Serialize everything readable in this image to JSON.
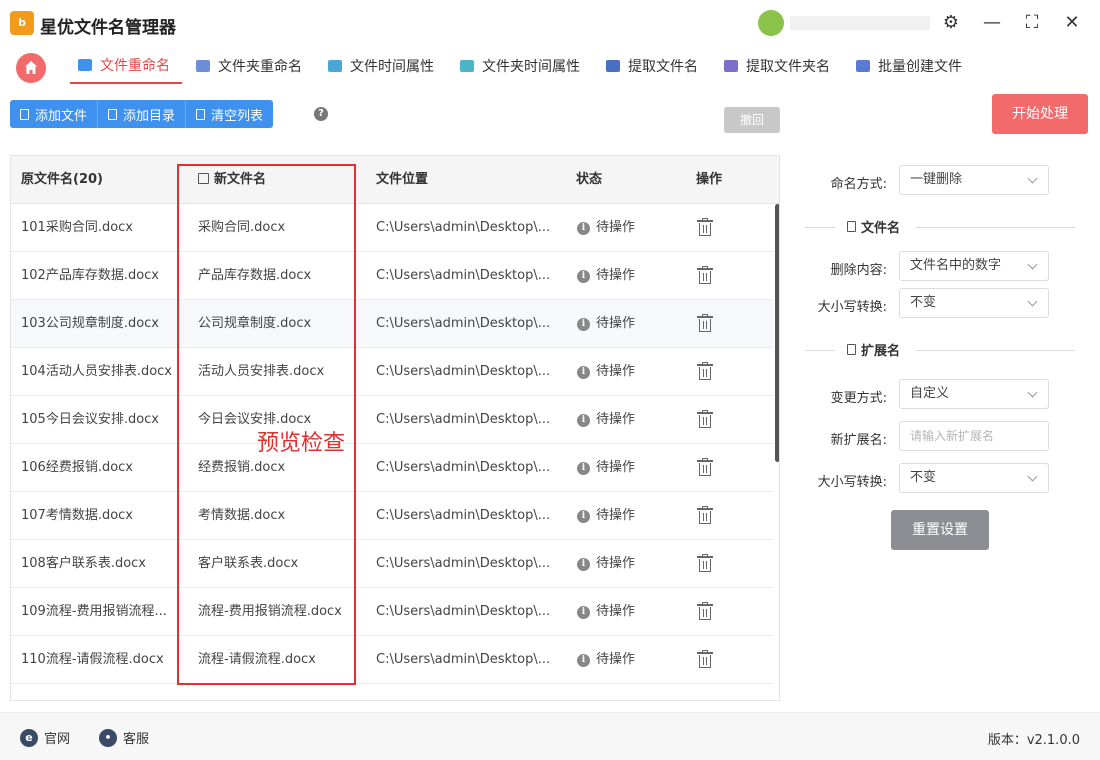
{
  "app": {
    "title": "星优文件名管理器",
    "logo_text": "b"
  },
  "window_controls": {
    "settings": "⚙",
    "minimize": "—",
    "maximize": "⛶",
    "close": "✕"
  },
  "tabs": [
    {
      "label": "文件重命名",
      "active": true,
      "icon": "file-rename-icon",
      "color": "#3f91f0"
    },
    {
      "label": "文件夹重命名",
      "active": false,
      "icon": "folder-rename-icon",
      "color": "#6a8ed8"
    },
    {
      "label": "文件时间属性",
      "active": false,
      "icon": "file-time-icon",
      "color": "#49a7d6"
    },
    {
      "label": "文件夹时间属性",
      "active": false,
      "icon": "folder-time-icon",
      "color": "#4cb4c9"
    },
    {
      "label": "提取文件名",
      "active": false,
      "icon": "extract-filename-icon",
      "color": "#4a6fc2"
    },
    {
      "label": "提取文件夹名",
      "active": false,
      "icon": "extract-foldername-icon",
      "color": "#7d6cc9"
    },
    {
      "label": "批量创建文件",
      "active": false,
      "icon": "batch-create-icon",
      "color": "#5a7ad6"
    }
  ],
  "toolbar": {
    "add_file": "添加文件",
    "add_dir": "添加目录",
    "clear_list": "清空列表",
    "help": "?",
    "undo": "撤回",
    "start": "开始处理"
  },
  "table": {
    "headers": {
      "original": "原文件名(20)",
      "new_name": "新文件名",
      "location": "文件位置",
      "status": "状态",
      "action": "操作"
    },
    "rows": [
      {
        "original": "101采购合同.docx",
        "new_name": "采购合同.docx",
        "location": "C:\\Users\\admin\\Desktop\\...",
        "status": "待操作"
      },
      {
        "original": "102产品库存数据.docx",
        "new_name": "产品库存数据.docx",
        "location": "C:\\Users\\admin\\Desktop\\...",
        "status": "待操作"
      },
      {
        "original": "103公司规章制度.docx",
        "new_name": "公司规章制度.docx",
        "location": "C:\\Users\\admin\\Desktop\\...",
        "status": "待操作"
      },
      {
        "original": "104活动人员安排表.docx",
        "new_name": "活动人员安排表.docx",
        "location": "C:\\Users\\admin\\Desktop\\...",
        "status": "待操作"
      },
      {
        "original": "105今日会议安排.docx",
        "new_name": "今日会议安排.docx",
        "location": "C:\\Users\\admin\\Desktop\\...",
        "status": "待操作"
      },
      {
        "original": "106经费报销.docx",
        "new_name": "经费报销.docx",
        "location": "C:\\Users\\admin\\Desktop\\...",
        "status": "待操作"
      },
      {
        "original": "107考情数据.docx",
        "new_name": "考情数据.docx",
        "location": "C:\\Users\\admin\\Desktop\\...",
        "status": "待操作"
      },
      {
        "original": "108客户联系表.docx",
        "new_name": "客户联系表.docx",
        "location": "C:\\Users\\admin\\Desktop\\...",
        "status": "待操作"
      },
      {
        "original": "109流程-费用报销流程...",
        "new_name": "流程-费用报销流程.docx",
        "location": "C:\\Users\\admin\\Desktop\\...",
        "status": "待操作"
      },
      {
        "original": "110流程-请假流程.docx",
        "new_name": "流程-请假流程.docx",
        "location": "C:\\Users\\admin\\Desktop\\...",
        "status": "待操作"
      }
    ],
    "highlighted_row": 2
  },
  "annotation": "预览检查",
  "panel": {
    "naming_method_label": "命名方式:",
    "naming_method_value": "一键删除",
    "filename_section": "文件名",
    "delete_content_label": "删除内容:",
    "delete_content_value": "文件名中的数字",
    "case_label_1": "大小写转换:",
    "case_value_1": "不变",
    "extension_section": "扩展名",
    "change_method_label": "变更方式:",
    "change_method_value": "自定义",
    "new_ext_label": "新扩展名:",
    "new_ext_placeholder": "请输入新扩展名",
    "case_label_2": "大小写转换:",
    "case_value_2": "不变",
    "reset": "重置设置"
  },
  "footer": {
    "website": "官网",
    "support": "客服",
    "version": "版本：v2.1.0.0"
  },
  "colors": {
    "accent_red": "#f26a6a",
    "primary_blue": "#3f91f0",
    "annotation_red": "#e03030"
  }
}
